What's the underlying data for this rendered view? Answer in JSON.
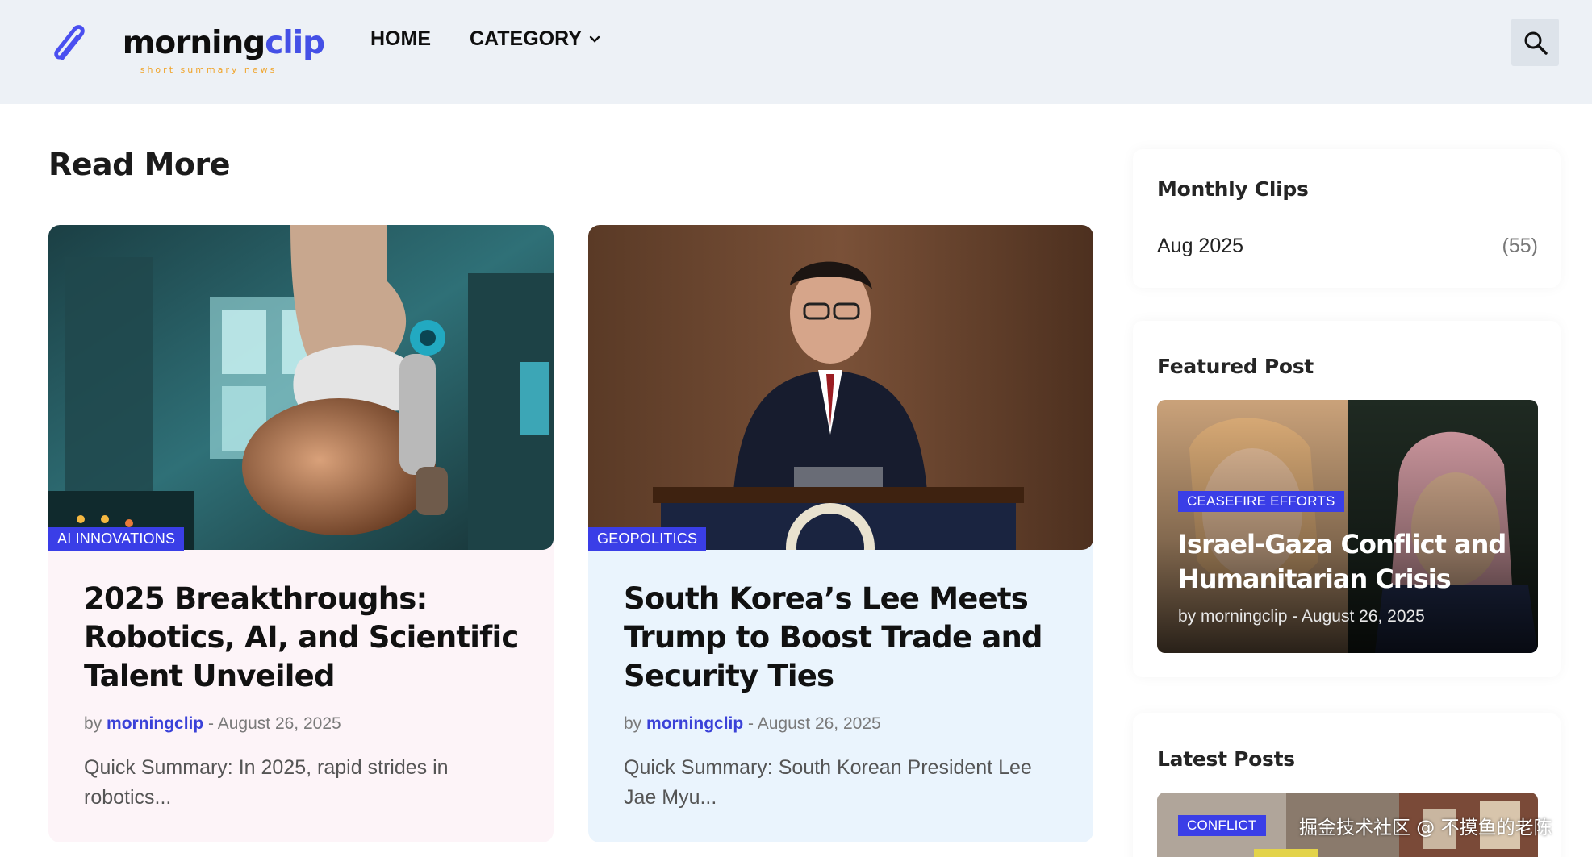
{
  "header": {
    "logo_main": "morning",
    "logo_accent": "clip",
    "logo_tagline": "short summary news",
    "nav": [
      {
        "label": "HOME"
      },
      {
        "label": "CATEGORY"
      }
    ]
  },
  "main": {
    "section_title": "Read More",
    "cards": [
      {
        "category": "AI INNOVATIONS",
        "title": "2025 Breakthroughs: Robotics, AI, and Scientific Talent Unveiled",
        "by": "by",
        "author": "morningclip",
        "separator": "-",
        "date": "August 26, 2025",
        "excerpt": "Quick Summary: In 2025, rapid strides in robotics..."
      },
      {
        "category": "GEOPOLITICS",
        "title": "South Korea’s Lee Meets Trump to Boost Trade and Security Ties",
        "by": "by",
        "author": "morningclip",
        "separator": "-",
        "date": "August 26, 2025",
        "excerpt": "Quick Summary: South Korean President Lee Jae Myu..."
      }
    ]
  },
  "sidebar": {
    "monthly": {
      "title": "Monthly Clips",
      "items": [
        {
          "label": "Aug 2025",
          "count": "(55)"
        }
      ]
    },
    "featured": {
      "title": "Featured Post",
      "category": "CEASEFIRE EFFORTS",
      "post_title": "Israel-Gaza Conflict and Humanitarian Crisis",
      "meta": "by morningclip - August 26, 2025"
    },
    "latest": {
      "title": "Latest Posts",
      "category": "CONFLICT"
    }
  },
  "watermark": "掘金技术社区 @ 不摸鱼的老陈",
  "colors": {
    "accent": "#3a3ee7",
    "header_bg": "#edf1f6",
    "card1_bg": "#fdf4f8",
    "card2_bg": "#eaf4fd",
    "logo_tagline": "#f0a42a"
  },
  "icons": [
    "paperclip-icon",
    "chevron-down-icon",
    "search-icon"
  ]
}
